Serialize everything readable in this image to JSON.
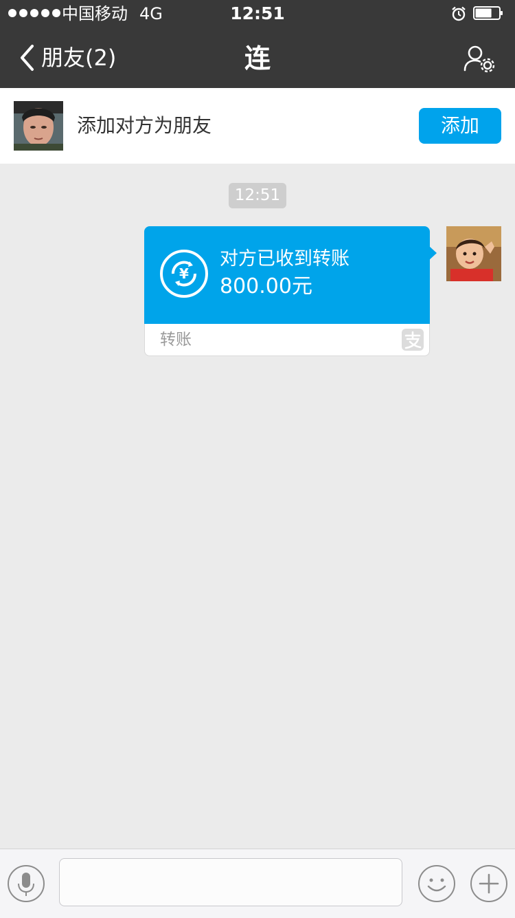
{
  "status_bar": {
    "carrier": "中国移动",
    "network": "4G",
    "time": "12:51",
    "signal_bars": 5,
    "battery_level": 0.7
  },
  "nav": {
    "back_label": "朋友(2)",
    "title": "连",
    "settings_icon": "user-settings-icon"
  },
  "banner": {
    "text": "添加对方为朋友",
    "add_label": "添加"
  },
  "chat": {
    "timestamp": "12:51",
    "transfer": {
      "status": "对方已收到转账",
      "amount": "800.00元",
      "label": "转账",
      "brand_icon": "alipay-icon"
    }
  },
  "input_bar": {
    "placeholder": "",
    "icons": [
      "voice-icon",
      "emoji-icon",
      "plus-icon"
    ]
  },
  "colors": {
    "nav_bg": "#393939",
    "accent": "#00a3ec",
    "chat_bg": "#ebebeb"
  }
}
